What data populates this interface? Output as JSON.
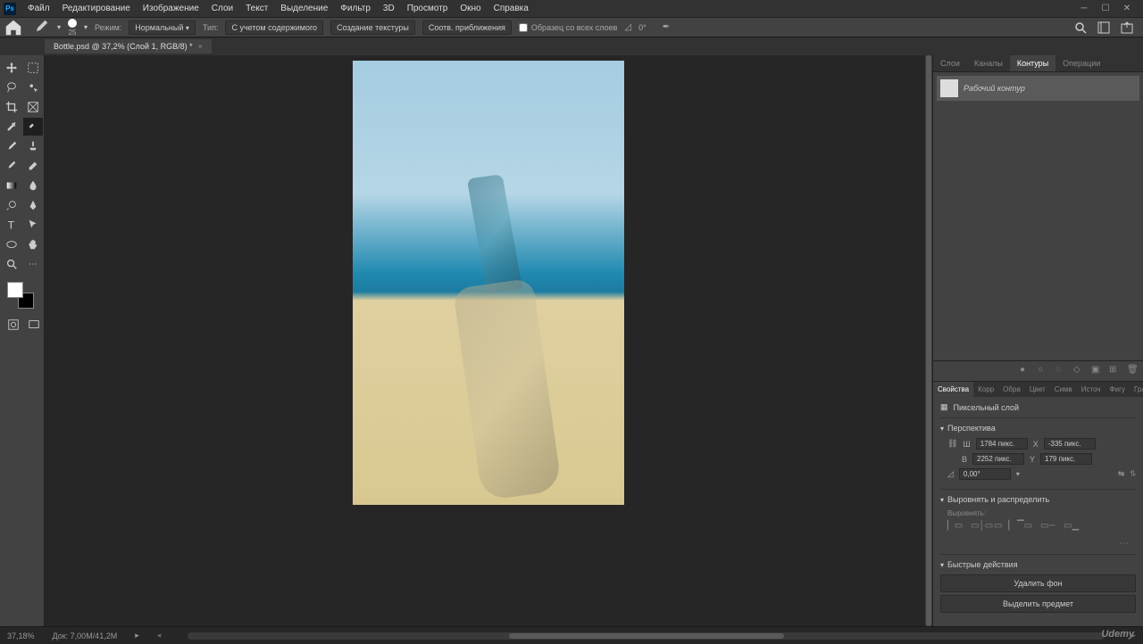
{
  "menubar": {
    "items": [
      "Файл",
      "Редактирование",
      "Изображение",
      "Слои",
      "Текст",
      "Выделение",
      "Фильтр",
      "3D",
      "Просмотр",
      "Окно",
      "Справка"
    ]
  },
  "optionsbar": {
    "brush_size": "25",
    "mode_label": "Режим:",
    "mode_value": "Нормальный",
    "type_label": "Тип:",
    "btn_content_aware": "С учетом содержимого",
    "btn_create_texture": "Создание текстуры",
    "btn_prox_match": "Соотв. приближения",
    "sample_all": "Образец со всех слоев",
    "angle_label": "0°"
  },
  "doctab": {
    "title": "Bottle.psd @ 37,2% (Слой 1, RGB/8) *"
  },
  "panels": {
    "top_tabs": [
      "Слои",
      "Каналы",
      "Контуры",
      "Операции"
    ],
    "active_top_tab": 2,
    "path_item": "Рабочий контур",
    "props_tabs": [
      "Свойства",
      "Корр",
      "Обра",
      "Цвет",
      "Симв",
      "Источ",
      "Фигу",
      "Гради"
    ],
    "active_props_tab": 0,
    "layer_type": "Пиксельный слой",
    "section_transform": "Перспектива",
    "w_label": "Ш",
    "w_value": "1784 пикс.",
    "x_label": "X",
    "x_value": "-335 пикс.",
    "h_label": "В",
    "h_value": "2252 пикс.",
    "y_label": "Y",
    "y_value": "179 пикс.",
    "angle_value": "0,00°",
    "section_align": "Выровнять и распределить",
    "align_label": "Выровнять:",
    "section_quick": "Быстрые действия",
    "btn_remove_bg": "Удалить фон",
    "btn_select_subject": "Выделить предмет"
  },
  "statusbar": {
    "zoom": "37,18%",
    "doc_info": "Док: 7,00M/41,2M"
  },
  "branding": "Udemy"
}
